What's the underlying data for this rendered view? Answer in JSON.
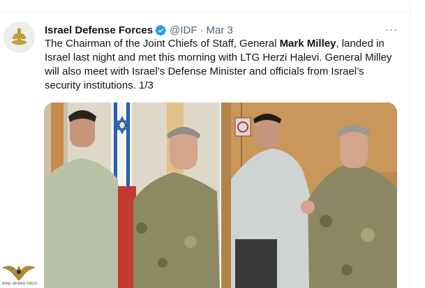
{
  "tweet": {
    "author_name": "Israel Defense Forces",
    "handle": "@IDF",
    "separator": "·",
    "date": "Mar 3",
    "more_label": "···",
    "text_parts": {
      "p1": "The Chairman of the Joint Chiefs of Staff, General ",
      "bold": "Mark Milley",
      "p2": ", landed in Israel last night and met this morning with LTG Herzi Halevi. General Milley will also meet with Israel’s Defense Minister and officials from Israel’s security institutions. 1/3"
    }
  },
  "watermark": {
    "text": "ISRAEL DEFENSE FORCES"
  },
  "colors": {
    "verified": "#1d9bf0",
    "muted": "#536471",
    "text": "#0f1419"
  },
  "icons": {
    "verified": "verified-badge-icon",
    "more": "more-icon",
    "avatar": "idf-emblem-icon"
  }
}
